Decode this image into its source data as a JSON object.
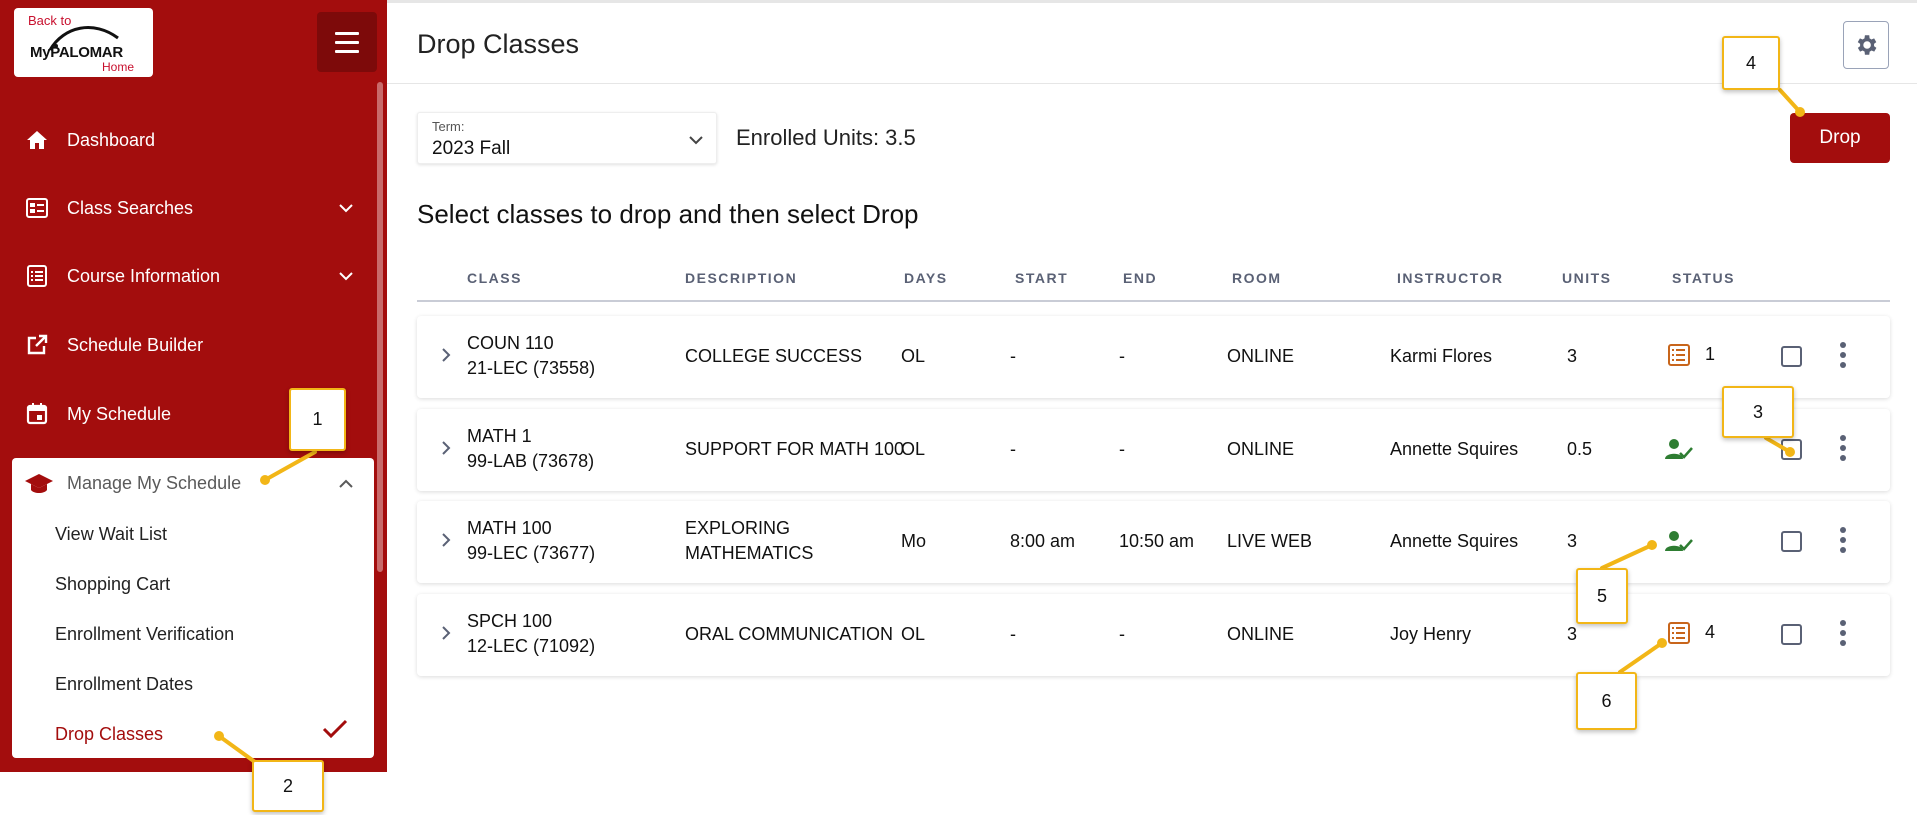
{
  "sidebar": {
    "logo": {
      "back_to": "Back to",
      "brand": "MyPALOMAR",
      "home": "Home"
    },
    "nav": [
      {
        "label": "Dashboard",
        "icon": "home-icon"
      },
      {
        "label": "Class Searches",
        "icon": "class-search-icon"
      },
      {
        "label": "Course Information",
        "icon": "course-info-icon"
      },
      {
        "label": "Schedule Builder",
        "icon": "external-link-icon"
      },
      {
        "label": "My Schedule",
        "icon": "calendar-icon"
      }
    ],
    "manage": {
      "label": "Manage My Schedule",
      "icon": "graduation-cap-icon",
      "items": [
        {
          "label": "View Wait List"
        },
        {
          "label": "Shopping Cart"
        },
        {
          "label": "Enrollment Verification"
        },
        {
          "label": "Enrollment Dates"
        },
        {
          "label": "Drop Classes",
          "active": true
        }
      ]
    }
  },
  "header": {
    "title": "Drop Classes"
  },
  "term": {
    "label": "Term:",
    "value": "2023 Fall"
  },
  "enrolled_units": "Enrolled Units: 3.5",
  "drop_button": "Drop",
  "instructions": "Select classes to drop and then select Drop",
  "table": {
    "headers": [
      "CLASS",
      "DESCRIPTION",
      "DAYS",
      "START",
      "END",
      "ROOM",
      "INSTRUCTOR",
      "UNITS",
      "STATUS"
    ],
    "rows": [
      {
        "class1": "COUN 110",
        "class2": "21-LEC (73558)",
        "desc1": "COLLEGE SUCCESS",
        "desc2": "",
        "days": "OL",
        "start": "-",
        "end": "-",
        "room": "ONLINE",
        "instructor": "Karmi Flores",
        "units": "3",
        "status": "waitlist",
        "status_num": "1"
      },
      {
        "class1": "MATH 1",
        "class2": "99-LAB (73678)",
        "desc1": "SUPPORT FOR MATH 100",
        "desc2": "",
        "days": "OL",
        "start": "-",
        "end": "-",
        "room": "ONLINE",
        "instructor": "Annette Squires",
        "units": "0.5",
        "status": "enrolled",
        "status_num": ""
      },
      {
        "class1": "MATH 100",
        "class2": "99-LEC (73677)",
        "desc1": "EXPLORING",
        "desc2": "MATHEMATICS",
        "days": "Mo",
        "start": "8:00 am",
        "end": "10:50 am",
        "room": "LIVE WEB",
        "instructor": "Annette Squires",
        "units": "3",
        "status": "enrolled",
        "status_num": ""
      },
      {
        "class1": "SPCH 100",
        "class2": "12-LEC (71092)",
        "desc1": "ORAL COMMUNICATION",
        "desc2": "",
        "days": "OL",
        "start": "-",
        "end": "-",
        "room": "ONLINE",
        "instructor": "Joy Henry",
        "units": "3",
        "status": "waitlist",
        "status_num": "4"
      }
    ]
  },
  "callouts": [
    "1",
    "2",
    "3",
    "4",
    "5",
    "6"
  ],
  "colors": {
    "brand": "#a30d0d",
    "callout_border": "#f2b617",
    "waitlist_icon": "#c8651b",
    "enrolled_icon": "#2e7d32",
    "header_text": "#5a6175"
  }
}
